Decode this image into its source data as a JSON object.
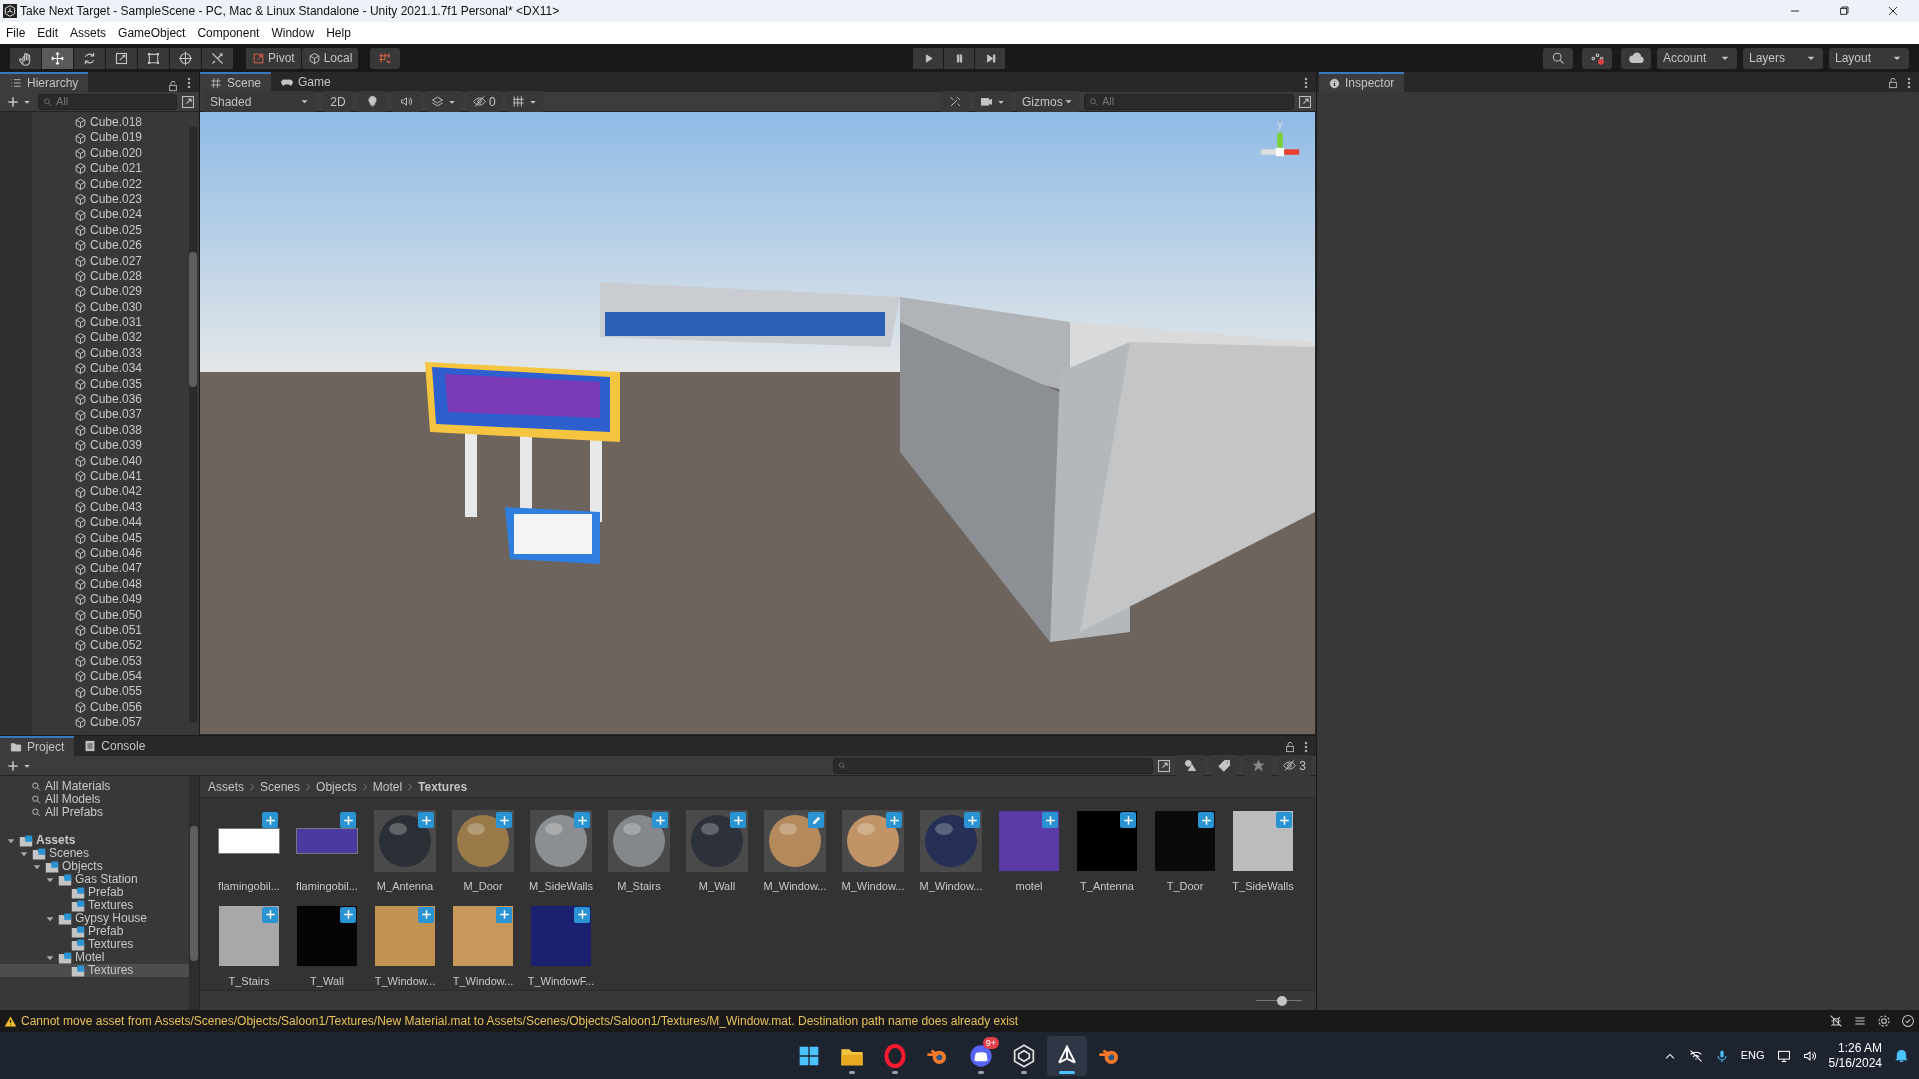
{
  "window": {
    "title": "Take Next Target - SampleScene - PC, Mac & Linux Standalone - Unity 2021.1.7f1 Personal* <DX11>"
  },
  "menu": [
    "File",
    "Edit",
    "Assets",
    "GameObject",
    "Component",
    "Window",
    "Help"
  ],
  "toolbar": {
    "tools": [
      {
        "kind": "hand",
        "selected": false
      },
      {
        "kind": "move",
        "selected": true
      },
      {
        "kind": "rotate",
        "selected": false
      },
      {
        "kind": "scale",
        "selected": false
      },
      {
        "kind": "rect",
        "selected": false
      },
      {
        "kind": "transform",
        "selected": false
      },
      {
        "kind": "custom",
        "selected": false
      }
    ],
    "pivot": "Pivot",
    "local": "Local",
    "account": "Account",
    "layers": "Layers",
    "layout": "Layout"
  },
  "hierarchy": {
    "title": "Hierarchy",
    "search_placeholder": "All",
    "items": [
      "Cube.018",
      "Cube.019",
      "Cube.020",
      "Cube.021",
      "Cube.022",
      "Cube.023",
      "Cube.024",
      "Cube.025",
      "Cube.026",
      "Cube.027",
      "Cube.028",
      "Cube.029",
      "Cube.030",
      "Cube.031",
      "Cube.032",
      "Cube.033",
      "Cube.034",
      "Cube.035",
      "Cube.036",
      "Cube.037",
      "Cube.038",
      "Cube.039",
      "Cube.040",
      "Cube.041",
      "Cube.042",
      "Cube.043",
      "Cube.044",
      "Cube.045",
      "Cube.046",
      "Cube.047",
      "Cube.048",
      "Cube.049",
      "Cube.050",
      "Cube.051",
      "Cube.052",
      "Cube.053",
      "Cube.054",
      "Cube.055",
      "Cube.056",
      "Cube.057"
    ]
  },
  "scene": {
    "tabs": [
      {
        "label": "Scene",
        "kind": "scene",
        "selected": true
      },
      {
        "label": "Game",
        "kind": "game",
        "selected": false
      }
    ],
    "shading": "Shaded",
    "mode_2d": "2D",
    "hidden_count": "0",
    "gizmos": "Gizmos",
    "search_placeholder": "All",
    "axis_label": "y"
  },
  "inspector": {
    "title": "Inspector"
  },
  "project": {
    "tabs": [
      {
        "label": "Project",
        "kind": "project",
        "selected": true
      },
      {
        "label": "Console",
        "kind": "console",
        "selected": false
      }
    ],
    "favorites": [
      "All Materials",
      "All Models",
      "All Prefabs"
    ],
    "tree": [
      {
        "label": "Assets",
        "expanded": true,
        "selected": false,
        "children": [
          {
            "label": "Scenes",
            "expanded": true,
            "selected": false,
            "children": [
              {
                "label": "Objects",
                "expanded": true,
                "selected": false,
                "children": [
                  {
                    "label": "Gas Station",
                    "expanded": true,
                    "selected": false,
                    "children": [
                      {
                        "label": "Prefab",
                        "selected": false
                      },
                      {
                        "label": "Textures",
                        "selected": false
                      }
                    ]
                  },
                  {
                    "label": "Gypsy House",
                    "expanded": true,
                    "selected": false,
                    "children": [
                      {
                        "label": "Prefab",
                        "selected": false
                      },
                      {
                        "label": "Textures",
                        "selected": false
                      }
                    ]
                  },
                  {
                    "label": "Motel",
                    "expanded": true,
                    "selected": false,
                    "children": [
                      {
                        "label": "Textures",
                        "selected": true
                      }
                    ]
                  }
                ]
              }
            ]
          }
        ]
      }
    ],
    "breadcrumb": [
      "Assets",
      "Scenes",
      "Objects",
      "Motel",
      "Textures"
    ],
    "hidden_count": "3",
    "assets": [
      {
        "name": "flamingobil...",
        "kind": "image",
        "color": "#ffffff",
        "badge": {
          "kind": "add"
        }
      },
      {
        "name": "flamingobil...",
        "kind": "image",
        "color": "#4b3aa0",
        "badge": {
          "kind": "add"
        }
      },
      {
        "name": "M_Antenna",
        "kind": "material",
        "color": "#2b2f36",
        "badge": {
          "kind": "add"
        }
      },
      {
        "name": "M_Door",
        "kind": "material",
        "color": "#9b7a4a",
        "badge": {
          "kind": "add"
        }
      },
      {
        "name": "M_SideWalls",
        "kind": "material",
        "color": "#8c8f92",
        "badge": {
          "kind": "add"
        }
      },
      {
        "name": "M_Stairs",
        "kind": "material",
        "color": "#85888b",
        "badge": {
          "kind": "add"
        }
      },
      {
        "name": "M_Wall",
        "kind": "material",
        "color": "#2c313a",
        "badge": {
          "kind": "add"
        }
      },
      {
        "name": "M_Window...",
        "kind": "material",
        "color": "#b48a5c",
        "badge": {
          "kind": "edit"
        }
      },
      {
        "name": "M_Window...",
        "kind": "material",
        "color": "#c09466",
        "badge": {
          "kind": "add"
        }
      },
      {
        "name": "M_Window...",
        "kind": "material",
        "color": "#262f55",
        "badge": {
          "kind": "add"
        }
      },
      {
        "name": "motel",
        "kind": "texture",
        "color": "#5b3aa6",
        "badge": {
          "kind": "add"
        }
      },
      {
        "name": "T_Antenna",
        "kind": "texture",
        "color": "#000000",
        "badge": {
          "kind": "add"
        }
      },
      {
        "name": "T_Door",
        "kind": "texture",
        "color": "#0a0a0a",
        "badge": {
          "kind": "add"
        }
      },
      {
        "name": "T_SideWalls",
        "kind": "texture",
        "color": "#bdbdbd",
        "badge": {
          "kind": "add"
        }
      },
      {
        "name": "T_Stairs",
        "kind": "texture",
        "color": "#a8a8a8",
        "badge": {
          "kind": "add"
        }
      },
      {
        "name": "T_Wall",
        "kind": "texture",
        "color": "#050505",
        "badge": {
          "kind": "add"
        }
      },
      {
        "name": "T_Window...",
        "kind": "texture",
        "color": "#c29253",
        "badge": {
          "kind": "add"
        }
      },
      {
        "name": "T_Window...",
        "kind": "texture",
        "color": "#c7985a",
        "badge": {
          "kind": "add"
        }
      },
      {
        "name": "T_WindowF...",
        "kind": "texture",
        "color": "#1b2070",
        "badge": {
          "kind": "add"
        }
      }
    ],
    "thumb_size": {
      "level": 0.57
    }
  },
  "status_bar": {
    "message": "Cannot move asset from Assets/Scenes/Objects/Saloon1/Textures/New Material.mat to Assets/Scenes/Objects/Saloon1/Textures/M_Window.mat. Destination path name does already exist"
  },
  "taskbar": {
    "apps": [
      {
        "kind": "start",
        "running": false,
        "active": false
      },
      {
        "kind": "files",
        "running": true,
        "active": false
      },
      {
        "kind": "opera",
        "running": true,
        "active": false
      },
      {
        "kind": "blender",
        "running": false,
        "active": false
      },
      {
        "kind": "discord",
        "running": true,
        "active": false,
        "badge": "9+"
      },
      {
        "kind": "hub",
        "running": true,
        "active": false
      },
      {
        "kind": "unity",
        "running": true,
        "active": true
      },
      {
        "kind": "blender",
        "running": false,
        "active": false
      }
    ],
    "language": "ENG",
    "time": "1:26 AM",
    "date": "5/16/2024"
  }
}
